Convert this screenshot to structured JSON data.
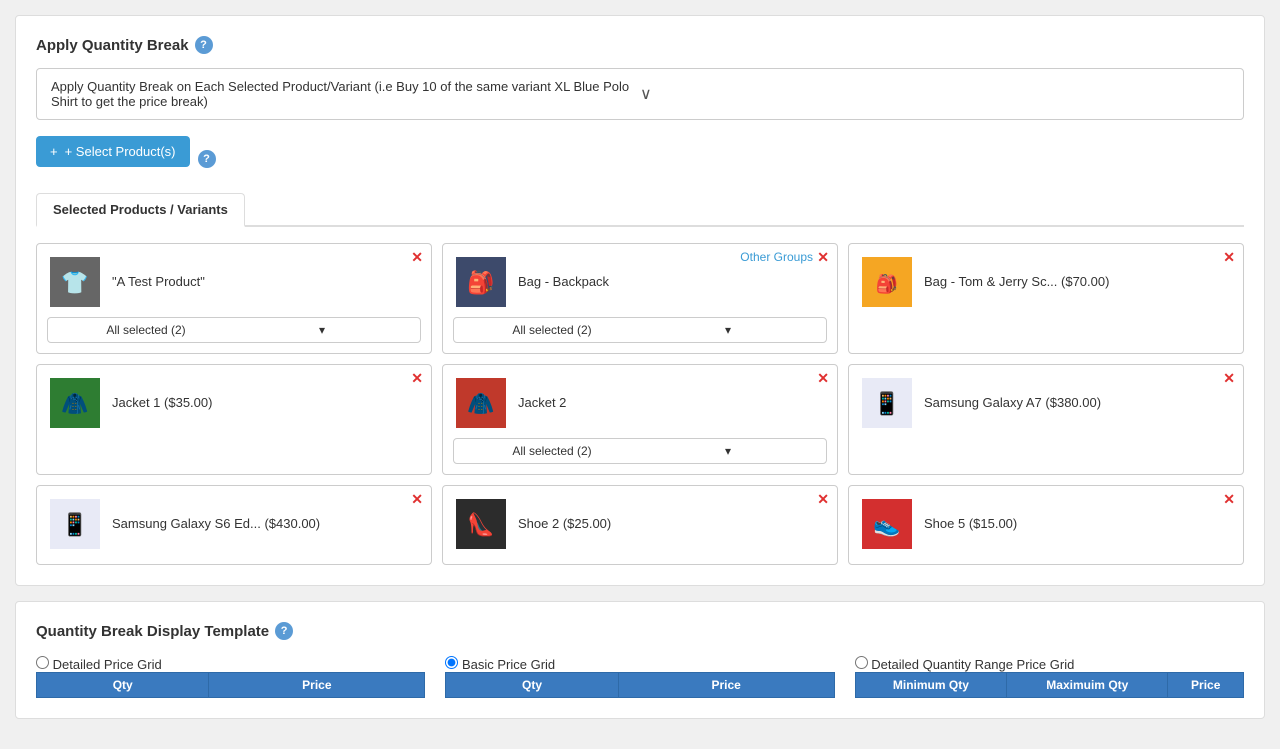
{
  "applyQtyBreak": {
    "title": "Apply Quantity Break",
    "dropdownValue": "Apply Quantity Break on Each Selected Product/Variant (i.e Buy 10 of the same variant XL Blue Polo Shirt to get the price break)",
    "selectBtn": "+ Select Product(s)"
  },
  "selectedProducts": {
    "tabLabel": "Selected Products / Variants",
    "products": [
      {
        "id": "test-product",
        "name": "\"A Test Product\"",
        "hasVariants": true,
        "variantLabel": "All selected (2)",
        "emoji": "👕",
        "bgColor": "#555",
        "hasOtherGroups": false
      },
      {
        "id": "bag-backpack",
        "name": "Bag - Backpack",
        "hasVariants": true,
        "variantLabel": "All selected (2)",
        "emoji": "🎒",
        "bgColor": "#334",
        "hasOtherGroups": true,
        "otherGroupsLabel": "Other Groups"
      },
      {
        "id": "bag-tom-jerry",
        "name": "Bag - Tom & Jerry Sc... ($70.00)",
        "hasVariants": false,
        "emoji": "🎒",
        "bgColor": "#f5a623",
        "hasOtherGroups": false
      },
      {
        "id": "jacket1",
        "name": "Jacket 1 ($35.00)",
        "hasVariants": false,
        "emoji": "🧥",
        "bgColor": "#2e7d32",
        "hasOtherGroups": false
      },
      {
        "id": "jacket2",
        "name": "Jacket 2",
        "hasVariants": true,
        "variantLabel": "All selected (2)",
        "emoji": "🧥",
        "bgColor": "#c0392b",
        "hasOtherGroups": false
      },
      {
        "id": "samsung-a7",
        "name": "Samsung Galaxy A7 ($380.00)",
        "hasVariants": false,
        "emoji": "📱",
        "bgColor": "#e8eaf6",
        "hasOtherGroups": false
      },
      {
        "id": "samsung-s6",
        "name": "Samsung Galaxy S6 Ed... ($430.00)",
        "hasVariants": false,
        "emoji": "📱",
        "bgColor": "#e8eaf6",
        "hasOtherGroups": false
      },
      {
        "id": "shoe2",
        "name": "Shoe 2 ($25.00)",
        "hasVariants": false,
        "emoji": "👠",
        "bgColor": "#222",
        "hasOtherGroups": false
      },
      {
        "id": "shoe5",
        "name": "Shoe 5 ($15.00)",
        "hasVariants": false,
        "emoji": "👟",
        "bgColor": "#d32f2f",
        "hasOtherGroups": false
      }
    ]
  },
  "quantityBreakDisplay": {
    "title": "Quantity Break Display Template",
    "options": [
      {
        "id": "detailed",
        "label": "Detailed Price Grid",
        "selected": false
      },
      {
        "id": "basic",
        "label": "Basic Price Grid",
        "selected": true
      },
      {
        "id": "detailed-range",
        "label": "Detailed Quantity Range Price Grid",
        "selected": false
      }
    ],
    "grids": [
      {
        "id": "detailed-grid",
        "headers": [
          "Qty",
          "Price"
        ],
        "rows": []
      },
      {
        "id": "basic-grid",
        "headers": [
          "Qty",
          "Price"
        ],
        "rows": []
      },
      {
        "id": "range-grid",
        "headers": [
          "Minimum Qty",
          "Maximuim Qty",
          "Price"
        ],
        "rows": []
      }
    ]
  },
  "icons": {
    "help": "?",
    "chevronDown": "∨",
    "plus": "+",
    "remove": "✕",
    "dropdownArrow": "▾"
  }
}
